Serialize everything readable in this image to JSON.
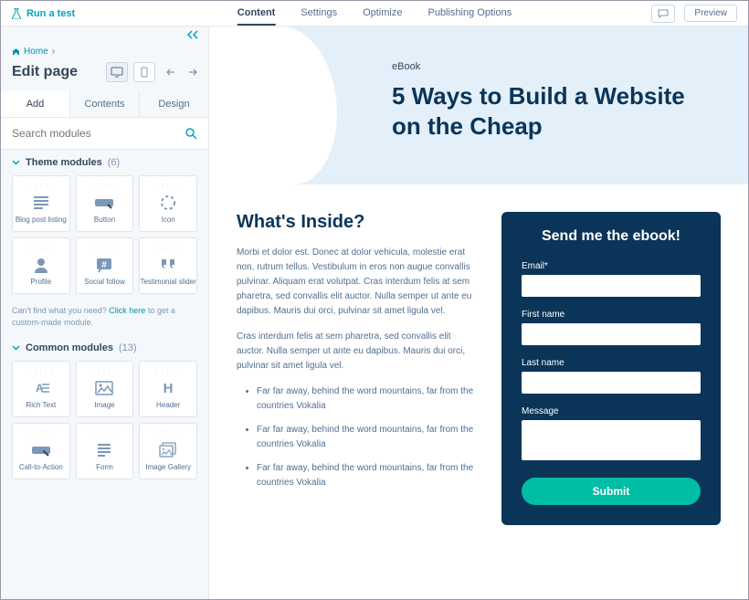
{
  "topbar": {
    "run_test": "Run a test",
    "nav": [
      "Content",
      "Settings",
      "Optimize",
      "Publishing Options"
    ],
    "active_nav": 0,
    "preview": "Preview"
  },
  "breadcrumb": {
    "home": "Home"
  },
  "edit": {
    "title": "Edit page"
  },
  "tabs": {
    "items": [
      "Add",
      "Contents",
      "Design"
    ],
    "active": 0
  },
  "search": {
    "placeholder": "Search modules"
  },
  "theme_modules": {
    "label": "Theme modules",
    "count": "(6)",
    "items": [
      {
        "name": "Blog post listing",
        "icon": "list"
      },
      {
        "name": "Button",
        "icon": "button"
      },
      {
        "name": "Icon",
        "icon": "spinner"
      },
      {
        "name": "Profile",
        "icon": "profile"
      },
      {
        "name": "Social follow",
        "icon": "hash"
      },
      {
        "name": "Testimonial slider",
        "icon": "quote"
      }
    ]
  },
  "hint": {
    "pre": "Can't find what you need? ",
    "link": "Click here",
    "post": " to get a custom-made module."
  },
  "common_modules": {
    "label": "Common modules",
    "count": "(13)",
    "items": [
      {
        "name": "Rich Text",
        "icon": "richtext"
      },
      {
        "name": "Image",
        "icon": "image"
      },
      {
        "name": "Header",
        "icon": "header"
      },
      {
        "name": "Call-to-Action",
        "icon": "cta"
      },
      {
        "name": "Form",
        "icon": "form"
      },
      {
        "name": "Image Gallery",
        "icon": "gallery"
      }
    ]
  },
  "page": {
    "eyebrow": "eBook",
    "hero_title": "5 Ways to Build a Website on the Cheap",
    "section_title": "What's Inside?",
    "para1": "Morbi et dolor est. Donec at dolor vehicula, molestie erat non, rutrum tellus. Vestibulum in eros non augue convallis pulvinar. Aliquam erat volutpat. Cras interdum felis at sem pharetra, sed convallis elit auctor. Nulla semper ut ante eu dapibus. Mauris dui orci, pulvinar sit amet ligula vel.",
    "para2": "Cras interdum felis at sem pharetra, sed convallis elit auctor. Nulla semper ut ante eu dapibus. Mauris dui orci, pulvinar sit amet ligula vel.",
    "bullets": [
      "Far far away, behind the word mountains, far from the countries Vokalia",
      "Far far away, behind the word mountains, far from the countries Vokalia",
      "Far far away, behind the word mountains, far from the countries Vokalia"
    ]
  },
  "form": {
    "title": "Send me the ebook!",
    "email": "Email*",
    "first": "First name",
    "last": "Last name",
    "message": "Message",
    "submit": "Submit"
  },
  "colors": {
    "accent": "#00a4bd",
    "brand_dark": "#0b3558",
    "cta": "#00bda5"
  }
}
